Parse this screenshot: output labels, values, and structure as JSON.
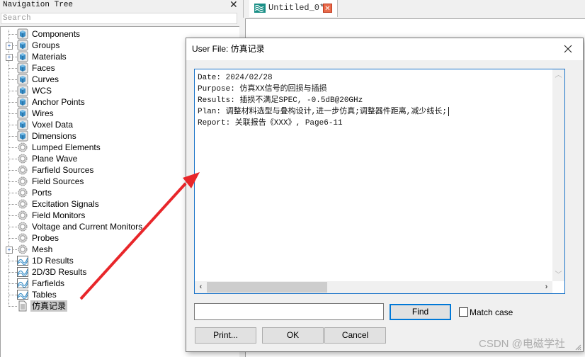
{
  "nav": {
    "title": "Navigation Tree",
    "search_placeholder": "Search",
    "items": [
      {
        "label": "Components",
        "icon": "cube-icon",
        "expandable": false
      },
      {
        "label": "Groups",
        "icon": "cube-icon",
        "expandable": true
      },
      {
        "label": "Materials",
        "icon": "cube-icon",
        "expandable": true
      },
      {
        "label": "Faces",
        "icon": "cube-icon",
        "expandable": false
      },
      {
        "label": "Curves",
        "icon": "cube-icon",
        "expandable": false
      },
      {
        "label": "WCS",
        "icon": "cube-icon",
        "expandable": false
      },
      {
        "label": "Anchor Points",
        "icon": "cube-icon",
        "expandable": false
      },
      {
        "label": "Wires",
        "icon": "cube-icon",
        "expandable": false
      },
      {
        "label": "Voxel Data",
        "icon": "cube-icon",
        "expandable": false
      },
      {
        "label": "Dimensions",
        "icon": "cube-icon",
        "expandable": false
      },
      {
        "label": "Lumped Elements",
        "icon": "gear-icon",
        "expandable": false
      },
      {
        "label": "Plane Wave",
        "icon": "gear-icon",
        "expandable": false
      },
      {
        "label": "Farfield Sources",
        "icon": "gear-icon",
        "expandable": false
      },
      {
        "label": "Field Sources",
        "icon": "gear-icon",
        "expandable": false
      },
      {
        "label": "Ports",
        "icon": "gear-icon",
        "expandable": false
      },
      {
        "label": "Excitation Signals",
        "icon": "gear-icon",
        "expandable": false
      },
      {
        "label": "Field Monitors",
        "icon": "gear-icon",
        "expandable": false
      },
      {
        "label": "Voltage and Current Monitors",
        "icon": "gear-icon",
        "expandable": false
      },
      {
        "label": "Probes",
        "icon": "gear-icon",
        "expandable": false
      },
      {
        "label": "Mesh",
        "icon": "gear-icon",
        "expandable": true
      },
      {
        "label": "1D Results",
        "icon": "chart-icon",
        "expandable": false
      },
      {
        "label": "2D/3D Results",
        "icon": "chart-icon",
        "expandable": false
      },
      {
        "label": "Farfields",
        "icon": "chart-icon",
        "expandable": false
      },
      {
        "label": "Tables",
        "icon": "chart-icon",
        "expandable": false
      },
      {
        "label": "仿真记录",
        "icon": "document-icon",
        "expandable": false,
        "selected": true
      }
    ]
  },
  "tabs": [
    {
      "label": "Untitled_0*",
      "icon": "wave-icon",
      "active": true
    }
  ],
  "dialog": {
    "title": "User File: 仿真记录",
    "content_lines": [
      "Date: 2024/02/28",
      "Purpose: 仿真XX信号的回损与插损",
      "Results: 插损不满足SPEC, -0.5dB@20GHz",
      "Plan: 调整材料选型与叠构设计,进一步仿真;调整器件距离,减少线长;",
      "Report: 关联报告《XXX》, Page6-11"
    ],
    "find_value": "",
    "find_label": "Find",
    "match_case_label": "Match case",
    "match_case_checked": false,
    "print_label": "Print...",
    "ok_label": "OK",
    "cancel_label": "Cancel"
  },
  "watermark": "CSDN @电磁学社",
  "colors": {
    "accent": "#0078d7",
    "arrow": "#e8262a",
    "tab_icon": "#1a8f86",
    "tab_close": "#e86a4a",
    "cube": "#3a8fc8"
  }
}
